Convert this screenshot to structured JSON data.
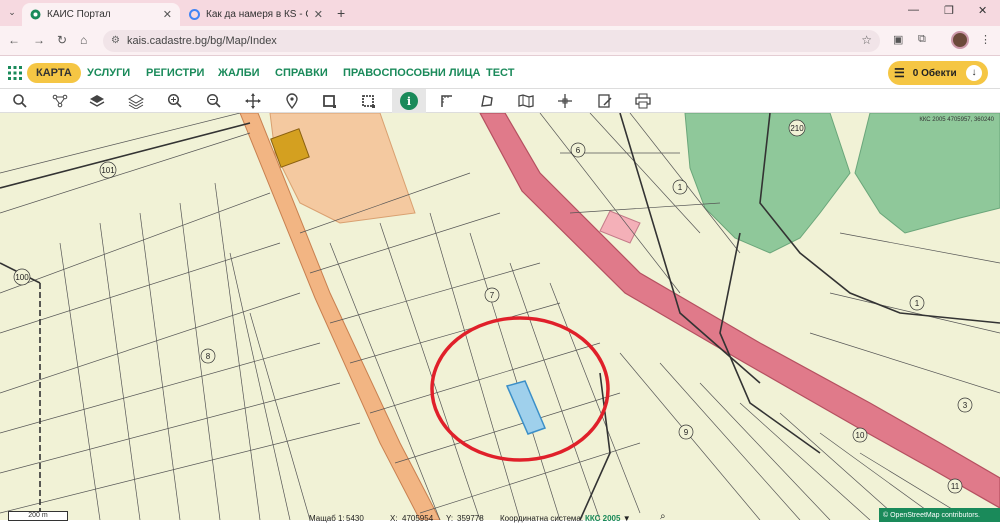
{
  "browser": {
    "tabs": [
      {
        "title": "КАИС Портал",
        "active": true
      },
      {
        "title": "Как да намеря в КS - Google",
        "active": false
      }
    ],
    "url": "kais.cadastre.bg/bg/Map/Index"
  },
  "nav": {
    "items": [
      "КАРТА",
      "УСЛУГИ",
      "РЕГИСТРИ",
      "ЖАЛБИ",
      "СПРАВКИ",
      "ПРАВОСПОСОБНИ ЛИЦА",
      "ТЕСТ"
    ],
    "active": "КАРТА",
    "objects_label": "0 Обекти"
  },
  "toolbar": {
    "tools": [
      "search-icon",
      "layers-tree-icon",
      "layers-icon",
      "layers-outline-icon",
      "zoom-in-icon",
      "zoom-out-icon",
      "pan-icon",
      "location-pin-icon",
      "select-rect-icon",
      "select-rect-dashed-icon",
      "info-icon",
      "measure-icon",
      "measure-area-icon",
      "map-book-icon",
      "coordinates-icon",
      "edit-doc-icon",
      "print-icon"
    ],
    "info_symbol": "i"
  },
  "map": {
    "crs_label": "ККС 2005 4705957, 360240",
    "parcel_labels": [
      "210",
      "6",
      "1",
      "101",
      "100",
      "7",
      "8",
      "9",
      "10",
      "1",
      "3",
      "11"
    ],
    "colors": {
      "background": "#f1f2d6",
      "road": "#e07a8a",
      "forest": "#8fc89a",
      "built": "#f4c9a0",
      "highlight": "#9fd0ec",
      "circle": "#e0202a"
    }
  },
  "status": {
    "scalebar": "200 m",
    "scale_label": "Мащаб 1:",
    "scale_value": "5430",
    "x_label": "X:",
    "x_value": "4705954",
    "y_label": "Y:",
    "y_value": "359778",
    "crs_label": "Координатна система:",
    "crs_value": "ККС 2005",
    "osm": "© OpenStreetMap contributors."
  }
}
